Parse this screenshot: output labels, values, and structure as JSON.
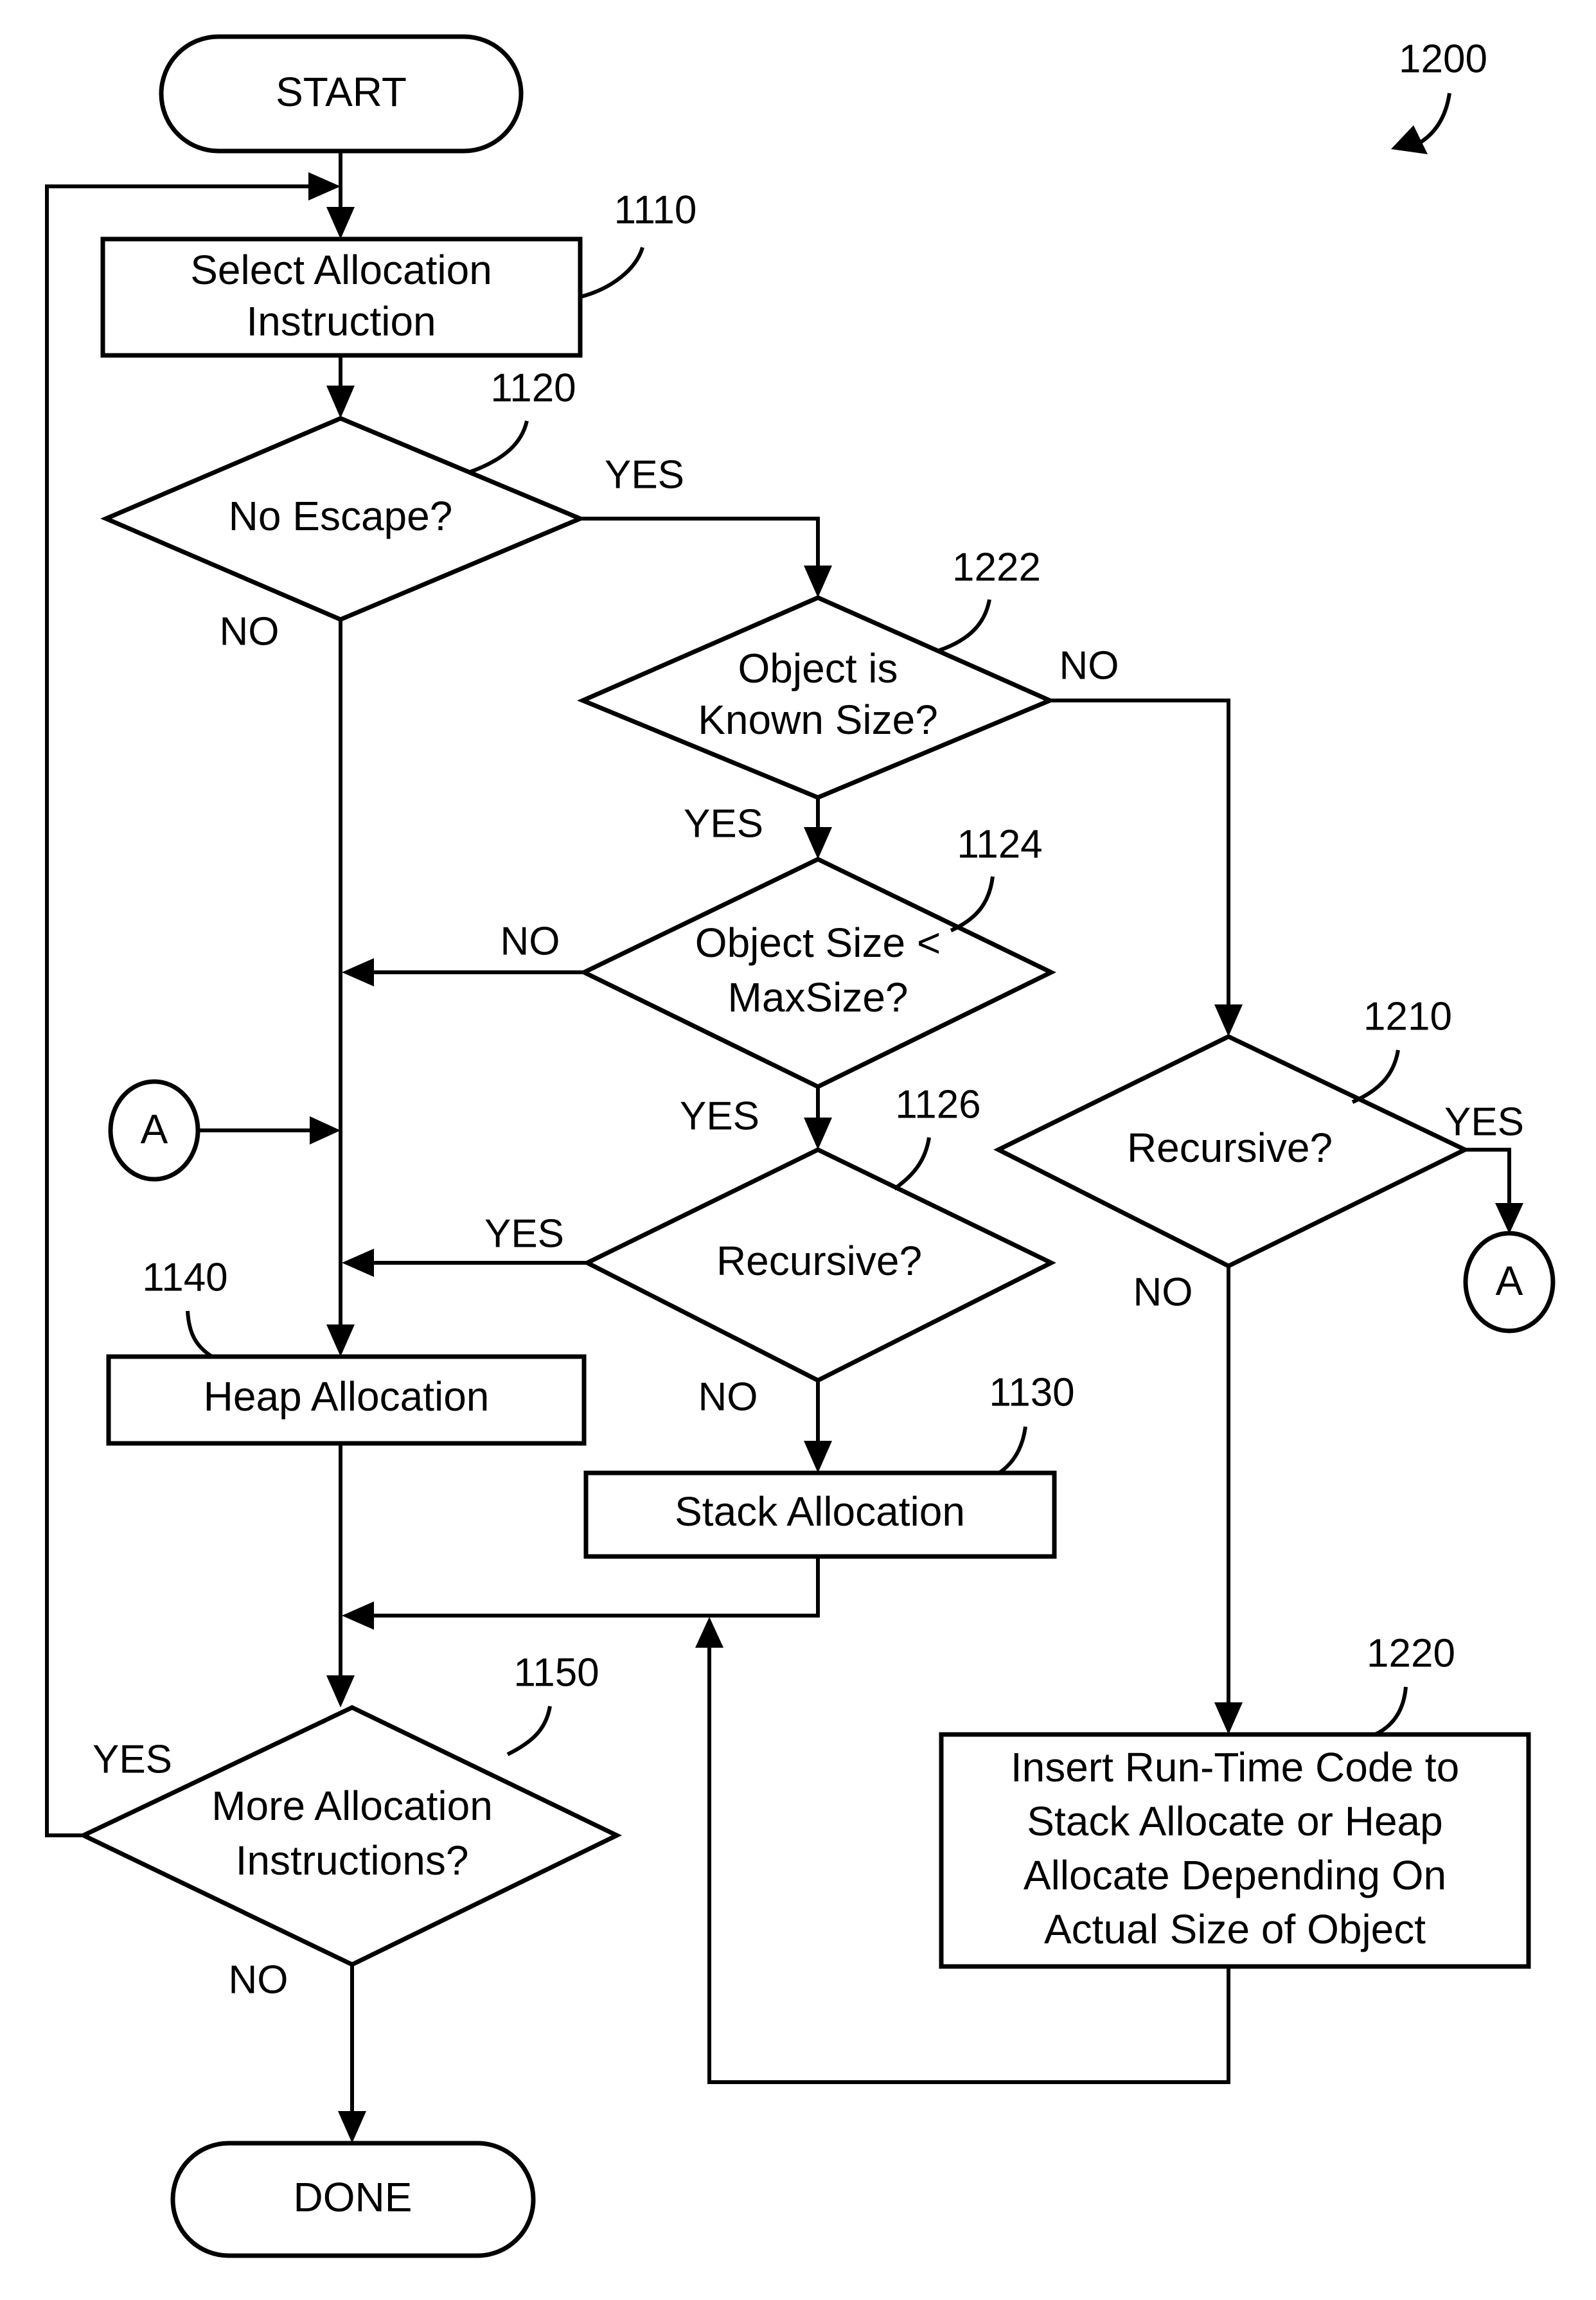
{
  "figure_ref": "1200",
  "terminals": {
    "start": "START",
    "done": "DONE"
  },
  "nodes": {
    "select": {
      "ref": "1110",
      "lines": [
        "Select Allocation",
        "Instruction"
      ]
    },
    "no_escape": {
      "ref": "1120",
      "lines": [
        "No Escape?"
      ]
    },
    "known_size": {
      "ref": "1222",
      "lines": [
        "Object is",
        "Known Size?"
      ]
    },
    "size_lt_max": {
      "ref": "1124",
      "lines": [
        "Object Size <",
        "MaxSize?"
      ]
    },
    "recursive_left": {
      "ref": "1126",
      "lines": [
        "Recursive?"
      ]
    },
    "recursive_right": {
      "ref": "1210",
      "lines": [
        "Recursive?"
      ]
    },
    "heap": {
      "ref": "1140",
      "lines": [
        "Heap Allocation"
      ]
    },
    "stack": {
      "ref": "1130",
      "lines": [
        "Stack Allocation"
      ]
    },
    "runtime": {
      "ref": "1220",
      "lines": [
        "Insert Run-Time Code to",
        "Stack Allocate or Heap",
        "Allocate Depending On",
        "Actual Size of Object"
      ]
    },
    "more": {
      "ref": "1150",
      "lines": [
        "More Allocation",
        "Instructions?"
      ]
    }
  },
  "connectors": {
    "left": "A",
    "right": "A"
  },
  "edge_labels": {
    "no_escape_yes": "YES",
    "no_escape_no": "NO",
    "known_size_no": "NO",
    "known_size_yes": "YES",
    "size_lt_max_no": "NO",
    "size_lt_max_yes": "YES",
    "recursive_left_yes": "YES",
    "recursive_left_no": "NO",
    "recursive_right_yes": "YES",
    "recursive_right_no": "NO",
    "more_yes": "YES",
    "more_no": "NO"
  }
}
